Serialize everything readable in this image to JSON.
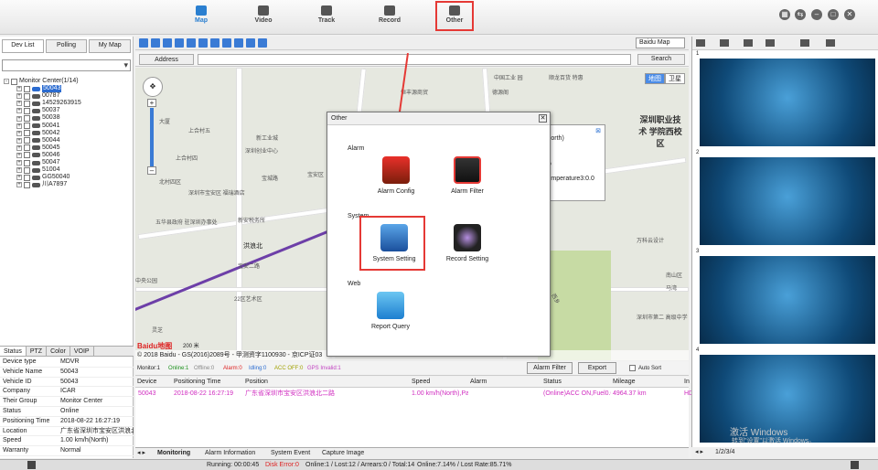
{
  "nav": {
    "map": "Map",
    "video": "Video",
    "track": "Track",
    "record": "Record",
    "other": "Other"
  },
  "left_tabs": [
    "Dev List",
    "Polling",
    "My Map"
  ],
  "tree": {
    "root": "Monitor Center(1/14)",
    "devices": [
      "50043",
      "00787",
      "14529263915",
      "50037",
      "50038",
      "50041",
      "50042",
      "50044",
      "50045",
      "50046",
      "50047",
      "51004",
      "GG50040",
      "川A7897"
    ]
  },
  "prop_tabs": [
    "Status",
    "PTZ",
    "Color",
    "VOIP"
  ],
  "props": [
    {
      "k": "Device type",
      "v": "MDVR"
    },
    {
      "k": "Vehicle Name",
      "v": "50043"
    },
    {
      "k": "Vehicle ID",
      "v": "50043"
    },
    {
      "k": "Company",
      "v": "ICAR"
    },
    {
      "k": "Their Group",
      "v": "Monitor Center"
    },
    {
      "k": "Status",
      "v": "Online"
    },
    {
      "k": "Positioning Time",
      "v": "2018-08-22 16:27:19"
    },
    {
      "k": "Location",
      "v": "广东省深圳市宝安区洪浪北"
    },
    {
      "k": "Speed",
      "v": "1.00 km/h(North)"
    },
    {
      "k": "Warranty",
      "v": "Normal"
    }
  ],
  "map": {
    "type_select": "Baidu Map",
    "address_label": "Address",
    "search": "Search",
    "types": [
      "地图",
      "卫星"
    ],
    "copyright": "© 2018 Baidu - GS(2016)2089号 - 甲测资字1100930 - 京ICP证03",
    "labels": [
      "中国工业 园",
      "顺龙百货 特惠",
      "德源阁",
      "恒丰源商贸",
      "深圳职业技术 学院西校区",
      "大厦",
      "上合村五",
      "新工业城",
      "上合村四",
      "深圳创业中心",
      "宝安区",
      "宝城路",
      "北村四区",
      "深圳市宝安区 福瑞酒店",
      "五华县政府 驻深圳办事处",
      "新安税务所",
      "洪浪北",
      "宝安二路",
      "22区艺术区",
      "中央公园",
      "灵芝",
      "万科云设计",
      "南山区",
      "马湾",
      "深圳市第二 高级中学",
      "西乡",
      "平山"
    ],
    "scale": "200 米"
  },
  "info_box": {
    "lines": [
      "(North)",
      "eo",
      "Temperature3:0.0"
    ]
  },
  "dialog": {
    "title": "Other",
    "alarm": "Alarm",
    "system": "System",
    "web": "Web",
    "items": {
      "alarm_config": "Alarm Config",
      "alarm_filter": "Alarm Filter",
      "system_setting": "System Setting",
      "record_setting": "Record Setting",
      "report_query": "Report Query"
    }
  },
  "monitor": {
    "monitor": "Monitor:1",
    "online": "Online:1",
    "offline": "Offline:0",
    "alarm": "Alarm:0",
    "idling": "Idling:0",
    "acc": "ACC OFF:0",
    "gps": "GPS Invalid:1",
    "alarm_filter_btn": "Alarm Filter",
    "export_btn": "Export",
    "autosort": "Auto Sort"
  },
  "grid": {
    "headers": [
      "Device",
      "Positioning Time",
      "Position",
      "Speed",
      "Alarm",
      "Status",
      "Mileage",
      "In"
    ],
    "row": [
      "50043",
      "2018-08-22 16:27:19",
      "广东省深圳市宝安区洪浪北二路",
      "1.00 km/h(North),Park",
      "",
      "(Online)ACC ON,Fuel0.00",
      "4964.37 km",
      "HD"
    ]
  },
  "bottom_tabs": [
    "Monitoring",
    "Alarm Information",
    "System Event",
    "Capture Image"
  ],
  "video": {
    "nums": [
      "1",
      "2",
      "3",
      "4"
    ],
    "pages": "1/2/3/4"
  },
  "watermark": [
    "激活 Windows",
    "转到\"设置\"以激活 Windows。"
  ],
  "status": {
    "running": "Running: 00:00:45",
    "disk": "Disk Error:0",
    "online": "Online:1 / Lost:12 / Arrears:0 / Total:14",
    "rate": "Online:7.14% / Lost Rate:85.71%"
  }
}
